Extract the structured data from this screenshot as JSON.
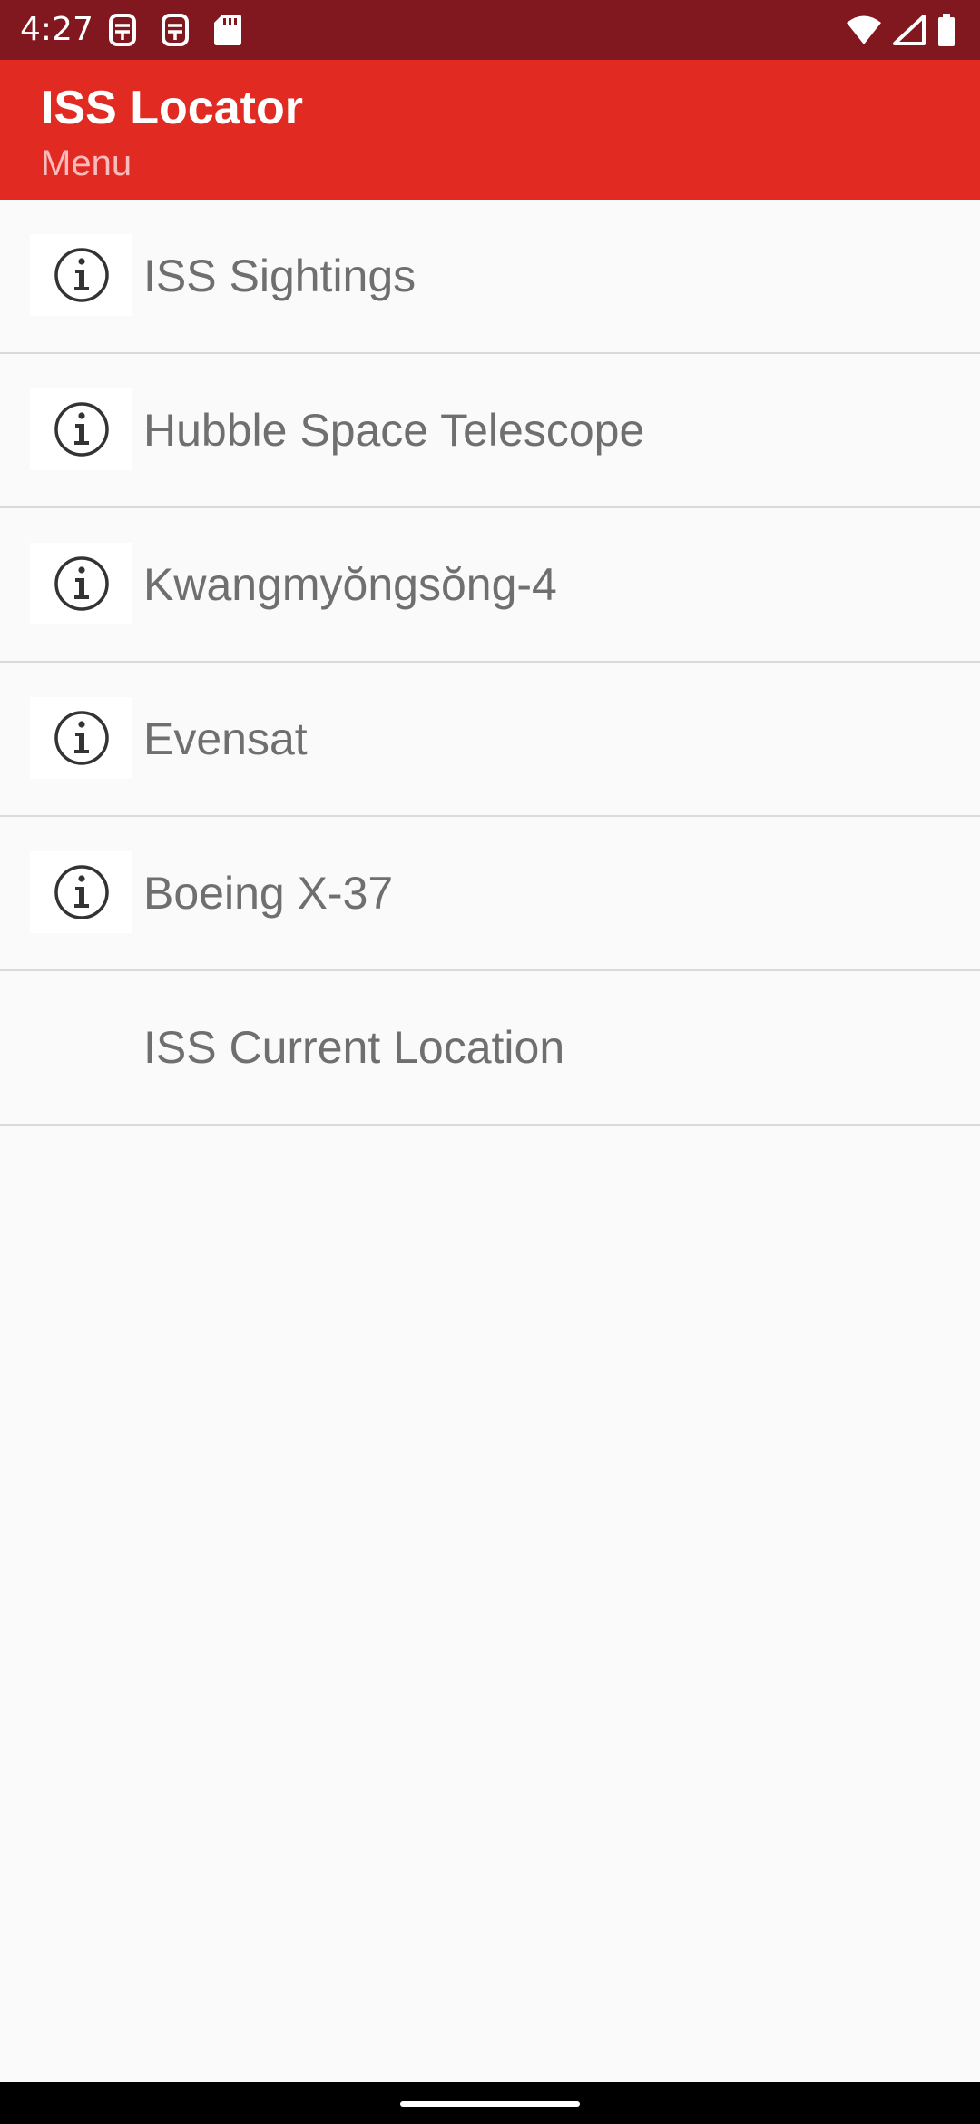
{
  "status_bar": {
    "time": "4:27",
    "left_icons": [
      "sim-icon",
      "sim-icon",
      "sd-card-icon"
    ],
    "right_icons": [
      "wifi-icon",
      "signal-icon",
      "battery-icon"
    ]
  },
  "app_bar": {
    "title": "ISS Locator",
    "subtitle": "Menu"
  },
  "menu": {
    "items": [
      {
        "label": "ISS Sightings",
        "icon": "info-icon"
      },
      {
        "label": "Hubble Space Telescope",
        "icon": "info-icon"
      },
      {
        "label": "Kwangmyŏngsŏng-4",
        "icon": "info-icon"
      },
      {
        "label": "Evensat",
        "icon": "info-icon"
      },
      {
        "label": "Boeing X-37",
        "icon": "info-icon"
      },
      {
        "label": "ISS Current Location",
        "icon": ""
      }
    ]
  },
  "colors": {
    "status_bar": "#82181f",
    "app_bar": "#e12a22",
    "subtitle": "#f9bcbc",
    "background": "#fafafa",
    "item_text": "#6f6f6f",
    "divider": "#d9d9d9"
  }
}
